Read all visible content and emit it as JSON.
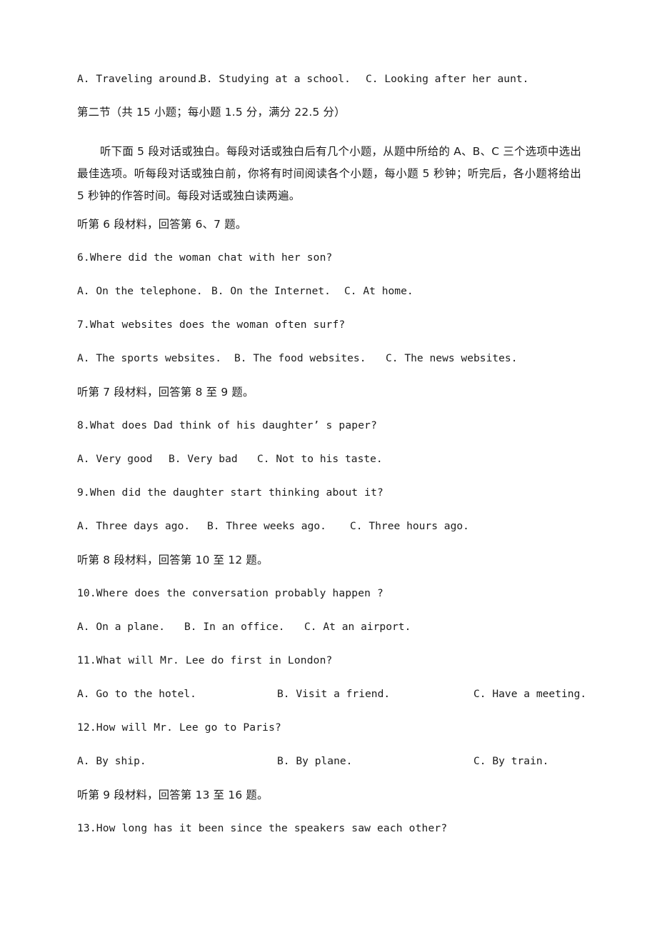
{
  "document": {
    "section_heading": "第二节（共 15 小题；每小题 1.5 分，满分 22.5 分）",
    "instructions": "听下面 5 段对话或独白。每段对话或独白后有几个小题，从题中所给的 A、B、C 三个选项中选出最佳选项。听每段对话或独白前，你将有时间阅读各个小题，每小题 5 秒钟；听完后，各小题将给出 5 秒钟的作答时间。每段对话或独白读两遍。",
    "top_options": {
      "a": "A. Traveling around.",
      "b": "B. Studying at a school.",
      "c": "C. Looking after her aunt."
    },
    "material_headings": {
      "m6": "听第 6 段材料，回答第 6、7 题。",
      "m7": "听第 7 段材料，回答第 8 至 9 题。",
      "m8": "听第 8 段材料，回答第 10 至 12 题。",
      "m9": "听第 9 段材料，回答第 13 至 16 题。"
    },
    "questions": [
      {
        "number": "6",
        "stem": "6.Where did the woman chat with her son?",
        "options": {
          "a": "A. On the telephone.",
          "b": "B. On the Internet.",
          "c": "C. At home."
        }
      },
      {
        "number": "7",
        "stem": "7.What websites does the woman often surf?",
        "options": {
          "a": "A. The sports websites.",
          "b": "B. The food websites.",
          "c": "C. The news websites."
        }
      },
      {
        "number": "8",
        "stem": "8.What does Dad think of his daughter’ s paper?",
        "options": {
          "a": "A. Very good",
          "b": "B. Very bad",
          "c": "C. Not to his taste."
        }
      },
      {
        "number": "9",
        "stem": "9.When did the daughter start thinking about it?",
        "options": {
          "a": "A. Three days ago.",
          "b": "B. Three weeks ago.",
          "c": "C. Three hours ago."
        }
      },
      {
        "number": "10",
        "stem": "10.Where does the conversation probably happen ?",
        "options": {
          "a": "A. On a plane.",
          "b": "B. In an office.",
          "c": "C. At an airport."
        }
      },
      {
        "number": "11",
        "stem": "11.What will Mr. Lee do first in London?",
        "options": {
          "a": "A. Go to the hotel.",
          "b": "B. Visit a friend.",
          "c": "C. Have a meeting."
        }
      },
      {
        "number": "12",
        "stem": "12.How will Mr. Lee go to Paris?",
        "options": {
          "a": "A. By ship.",
          "b": "B. By plane.",
          "c": "C. By train."
        }
      },
      {
        "number": "13",
        "stem": "13.How long has it been since the speakers saw each other?",
        "options": null
      }
    ]
  }
}
